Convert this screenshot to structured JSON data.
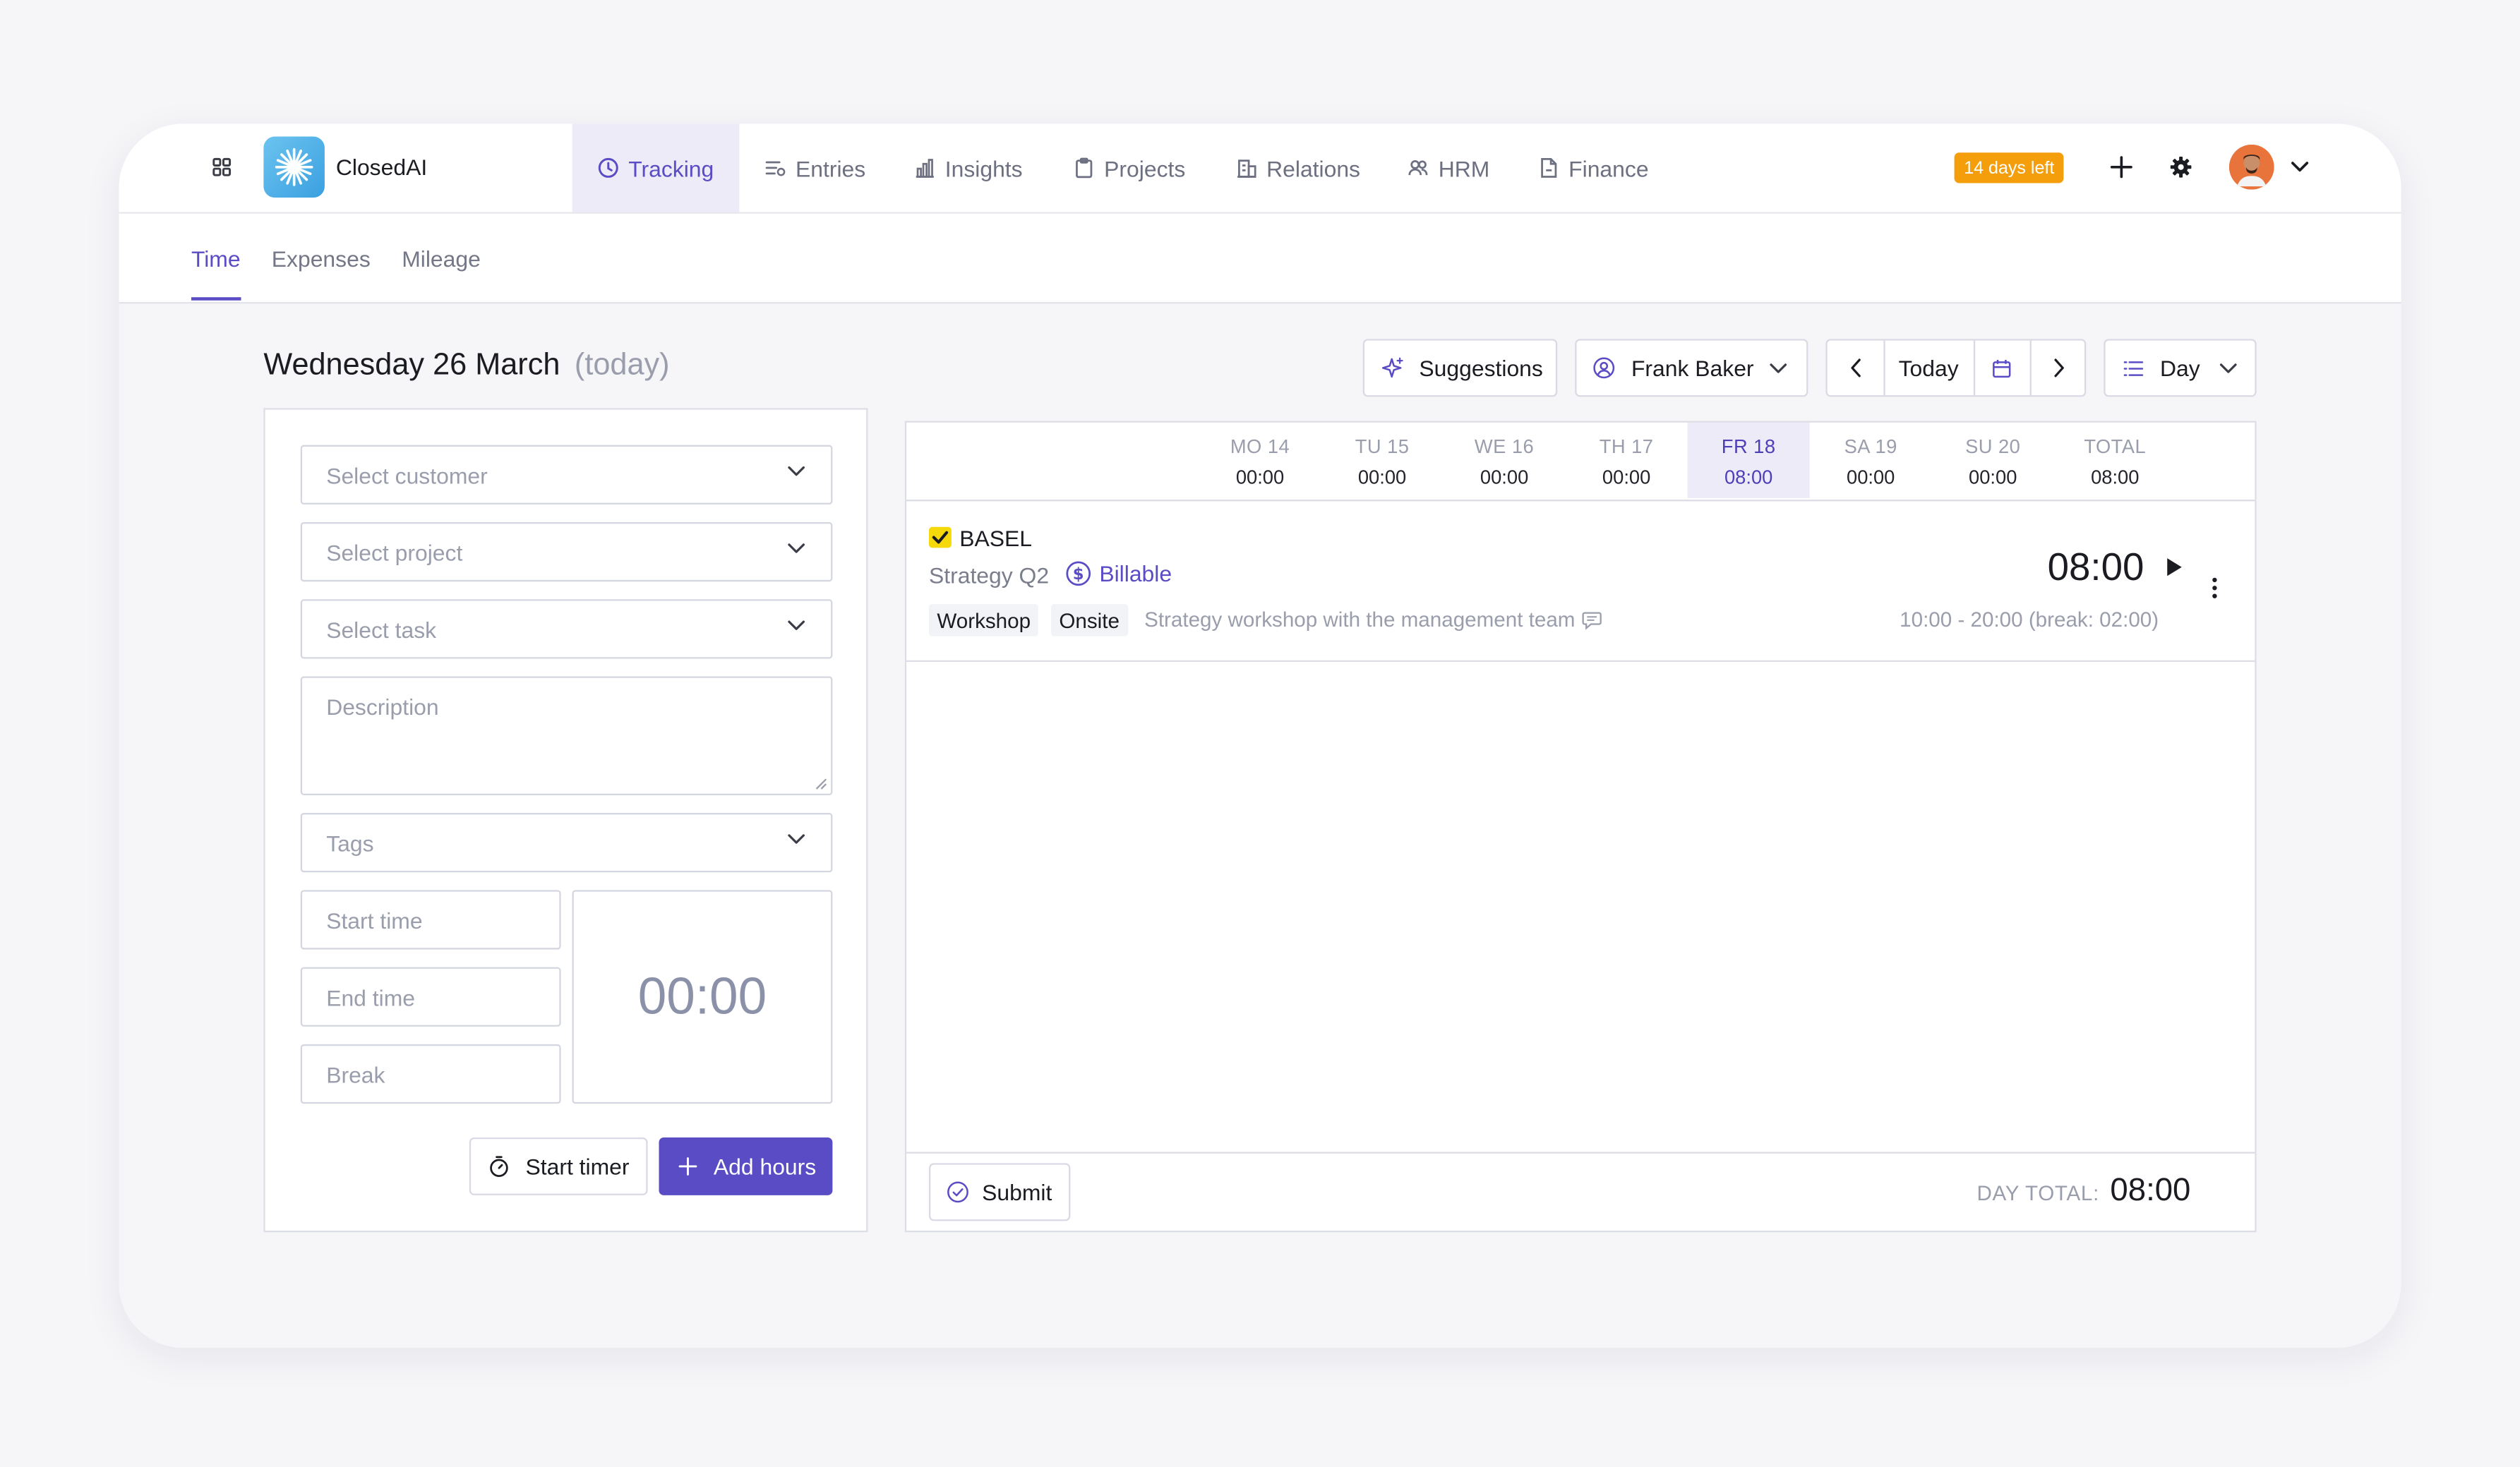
{
  "app": {
    "name": "ClosedAI"
  },
  "nav": {
    "tracking": "Tracking",
    "entries": "Entries",
    "insights": "Insights",
    "projects": "Projects",
    "relations": "Relations",
    "hrm": "HRM",
    "finance": "Finance"
  },
  "trial_badge": "14 days left",
  "subnav": {
    "time": "Time",
    "expenses": "Expenses",
    "mileage": "Mileage"
  },
  "page": {
    "date_title": "Wednesday 26 March",
    "today_label": "(today)"
  },
  "toolbar": {
    "suggestions": "Suggestions",
    "user": "Frank Baker",
    "today": "Today",
    "view": "Day"
  },
  "form": {
    "customer_placeholder": "Select customer",
    "project_placeholder": "Select project",
    "task_placeholder": "Select task",
    "description_placeholder": "Description",
    "tags_placeholder": "Tags",
    "start_placeholder": "Start time",
    "end_placeholder": "End time",
    "break_placeholder": "Break",
    "duration": "00:00",
    "start_timer": "Start timer",
    "add_hours": "Add hours"
  },
  "week": {
    "days": [
      {
        "label": "MO 14",
        "value": "00:00"
      },
      {
        "label": "TU 15",
        "value": "00:00"
      },
      {
        "label": "WE 16",
        "value": "00:00"
      },
      {
        "label": "TH 17",
        "value": "00:00"
      },
      {
        "label": "FR 18",
        "value": "08:00"
      },
      {
        "label": "SA 19",
        "value": "00:00"
      },
      {
        "label": "SU 20",
        "value": "00:00"
      },
      {
        "label": "TOTAL",
        "value": "08:00"
      }
    ],
    "active_index": 4
  },
  "entry": {
    "customer": "BASEL",
    "project": "Strategy Q2",
    "billable": "Billable",
    "tags": [
      "Workshop",
      "Onsite"
    ],
    "description": "Strategy workshop with the management team",
    "duration": "08:00",
    "time_range": "10:00 - 20:00 (break: 02:00)"
  },
  "footer": {
    "submit": "Submit",
    "day_total_label": "DAY TOTAL:",
    "day_total": "08:00"
  },
  "colors": {
    "accent": "#5a4cc4",
    "badge": "#f59e0b",
    "customer_marker": "#f5d90a"
  },
  "icons": [
    "grid-icon",
    "clock-icon",
    "list-icon",
    "bar-chart-icon",
    "clipboard-icon",
    "building-icon",
    "people-icon",
    "document-icon",
    "plus-icon",
    "gear-icon",
    "chevron-down-icon",
    "sparkle-icon",
    "user-circle-icon",
    "chevron-left-icon",
    "chevron-right-icon",
    "calendar-icon",
    "list-view-icon",
    "check-icon",
    "dollar-icon",
    "comment-icon",
    "play-icon",
    "kebab-icon",
    "stopwatch-icon",
    "check-circle-icon"
  ]
}
